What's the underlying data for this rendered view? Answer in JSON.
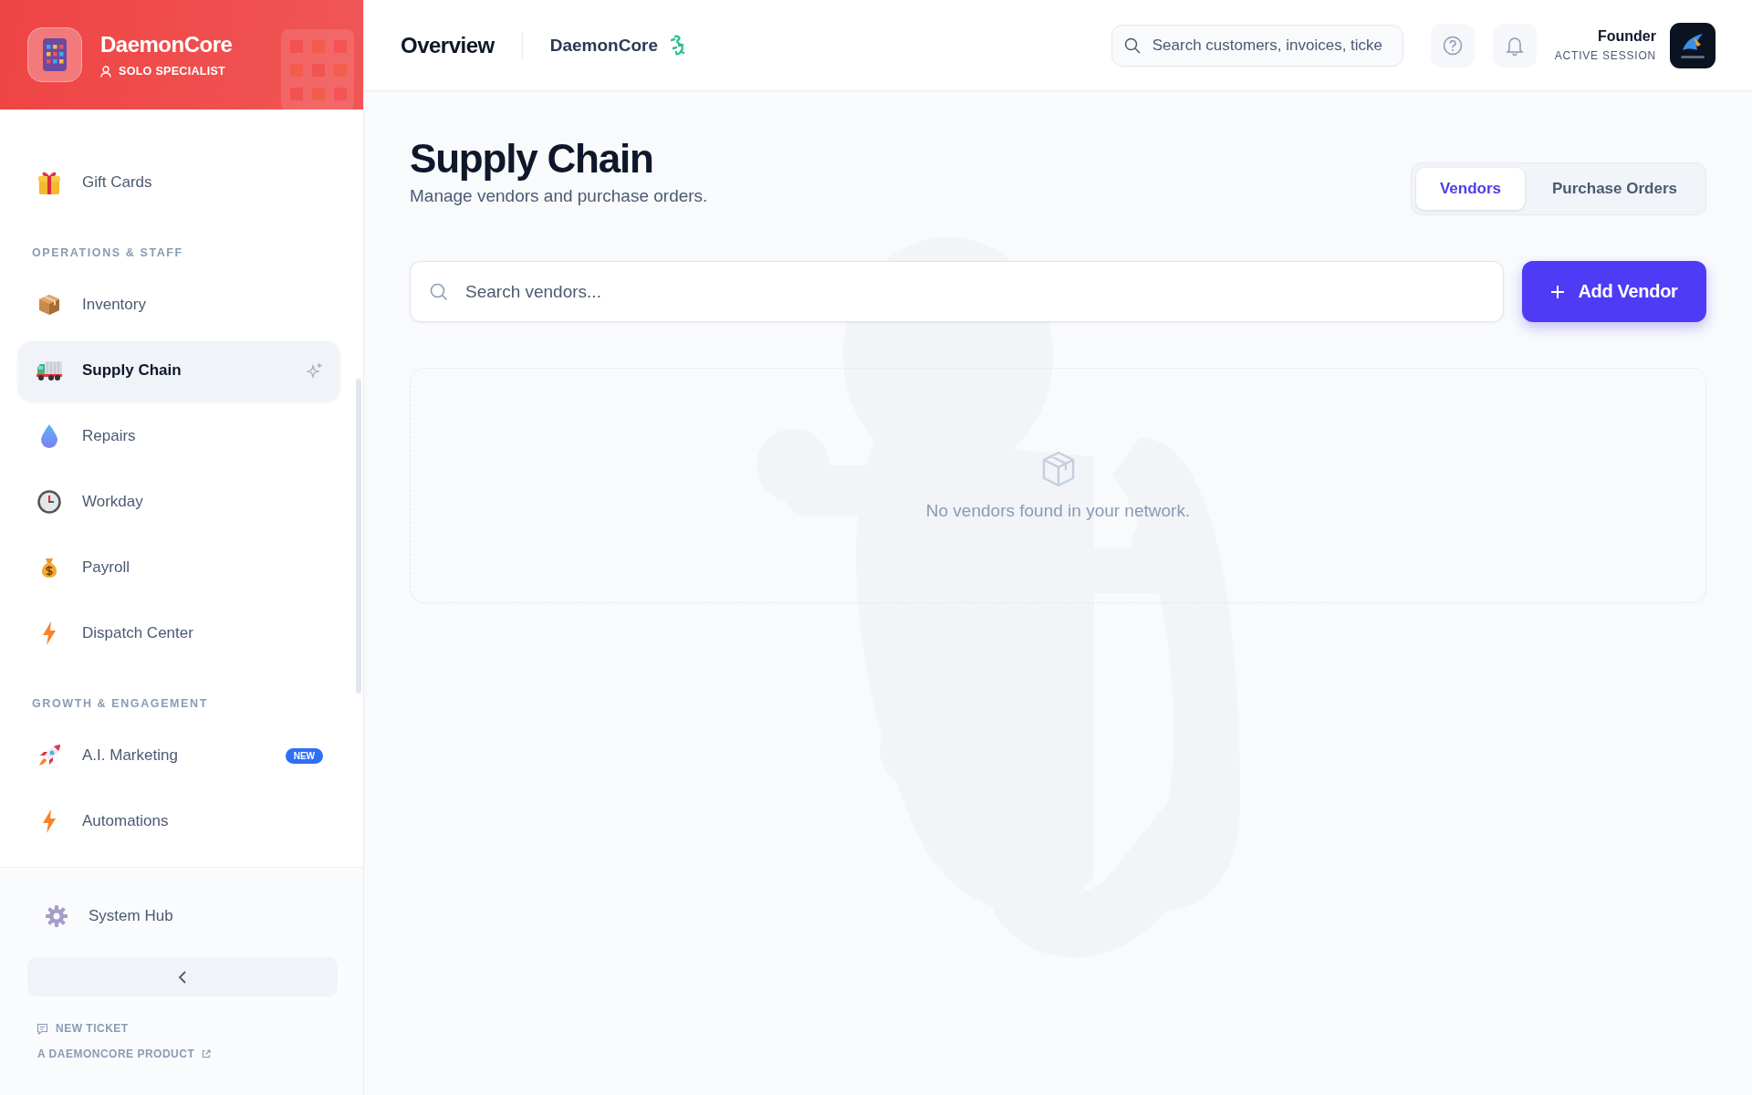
{
  "sidebar": {
    "brand": {
      "name": "DaemonCore",
      "role": "SOLO SPECIALIST"
    },
    "sections": [
      {
        "items": [
          {
            "label": "Gift Cards",
            "selected": false
          }
        ]
      },
      {
        "title": "OPERATIONS & STAFF",
        "items": [
          {
            "label": "Inventory",
            "selected": false
          },
          {
            "label": "Supply Chain",
            "selected": true
          },
          {
            "label": "Repairs",
            "selected": false
          },
          {
            "label": "Workday",
            "selected": false
          },
          {
            "label": "Payroll",
            "selected": false
          },
          {
            "label": "Dispatch Center",
            "selected": false
          }
        ]
      },
      {
        "title": "GROWTH & ENGAGEMENT",
        "items": [
          {
            "label": "A.I. Marketing",
            "selected": false,
            "badge": "NEW"
          },
          {
            "label": "Automations",
            "selected": false
          }
        ]
      }
    ],
    "footer": {
      "system_hub": "System Hub",
      "links": [
        "NEW TICKET",
        "A DAEMONCORE PRODUCT"
      ]
    }
  },
  "topbar": {
    "title": "Overview",
    "workspace": "DaemonCore",
    "search": {
      "placeholder": "Search customers, invoices, ticke"
    },
    "user": {
      "name": "Founder",
      "status": "ACTIVE SESSION"
    }
  },
  "page": {
    "title": "Supply Chain",
    "subtitle": "Manage vendors and purchase orders.",
    "tabs": [
      {
        "label": "Vendors",
        "selected": true
      },
      {
        "label": "Purchase Orders",
        "selected": false
      }
    ],
    "search": {
      "placeholder": "Search vendors..."
    },
    "add_button": "Add Vendor",
    "empty_message": "No vendors found in your network."
  }
}
